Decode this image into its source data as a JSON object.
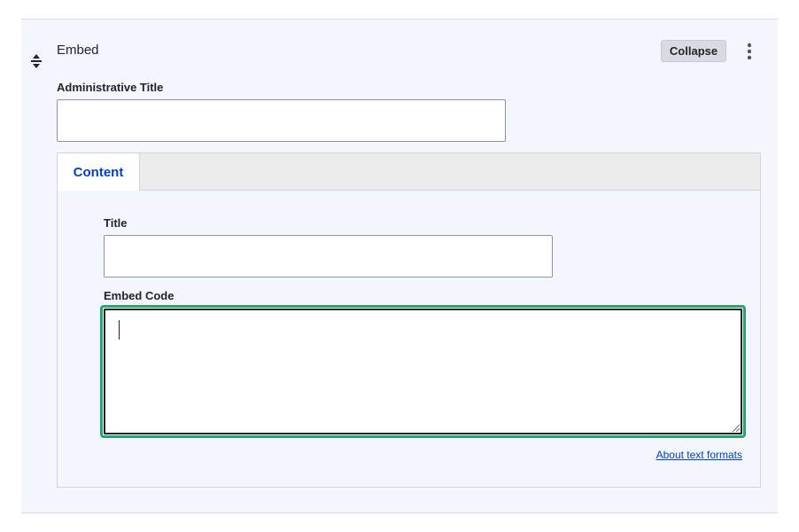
{
  "paragraph": {
    "type_label": "Embed",
    "collapse_label": "Collapse",
    "icons": {
      "drag": "drag-handle-icon",
      "actions": "kebab-menu-icon"
    }
  },
  "admin_title": {
    "label": "Administrative Title",
    "value": ""
  },
  "tabs": [
    {
      "label": "Content",
      "active": true
    }
  ],
  "content": {
    "title": {
      "label": "Title",
      "value": ""
    },
    "embed_code": {
      "label": "Embed Code",
      "value": ""
    }
  },
  "about_text_formats": "About text formats",
  "colors": {
    "panel_bg": "#f3f6fd",
    "focus_ring": "#26a769",
    "link": "#003ecc",
    "button_bg": "#d9dbe0"
  }
}
